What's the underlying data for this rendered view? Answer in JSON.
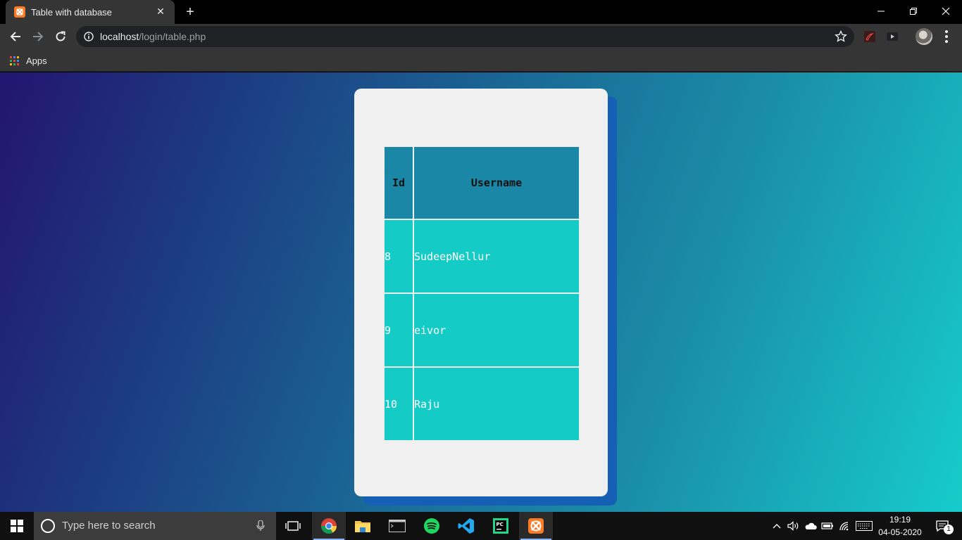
{
  "browser": {
    "tab": {
      "title": "Table with database",
      "close_glyph": "✕"
    },
    "new_tab_glyph": "+",
    "address": {
      "host": "localhost",
      "path": "/login/table.php"
    },
    "bookmarks": {
      "apps_label": "Apps"
    }
  },
  "page": {
    "table": {
      "headers": [
        "Id",
        "Username"
      ],
      "rows": [
        {
          "id": "8",
          "username": "SudeepNellur"
        },
        {
          "id": "9",
          "username": "eivor"
        },
        {
          "id": "10",
          "username": "Raju"
        }
      ]
    },
    "colors": {
      "header_bg": "#1a87a7",
      "cell_bg": "#14cbc6",
      "card_bg": "#f0f0f0",
      "card_shadow": "#1560b5",
      "gradient_start": "#231570",
      "gradient_end": "#16cccb"
    }
  },
  "taskbar": {
    "search_placeholder": "Type here to search",
    "apps": [
      "chrome-icon",
      "file-explorer-icon",
      "terminal-icon",
      "spotify-icon",
      "vscode-icon",
      "pycharm-icon",
      "xampp-icon"
    ],
    "clock": {
      "time": "19:19",
      "date": "04-05-2020"
    },
    "notification_count": "1"
  }
}
